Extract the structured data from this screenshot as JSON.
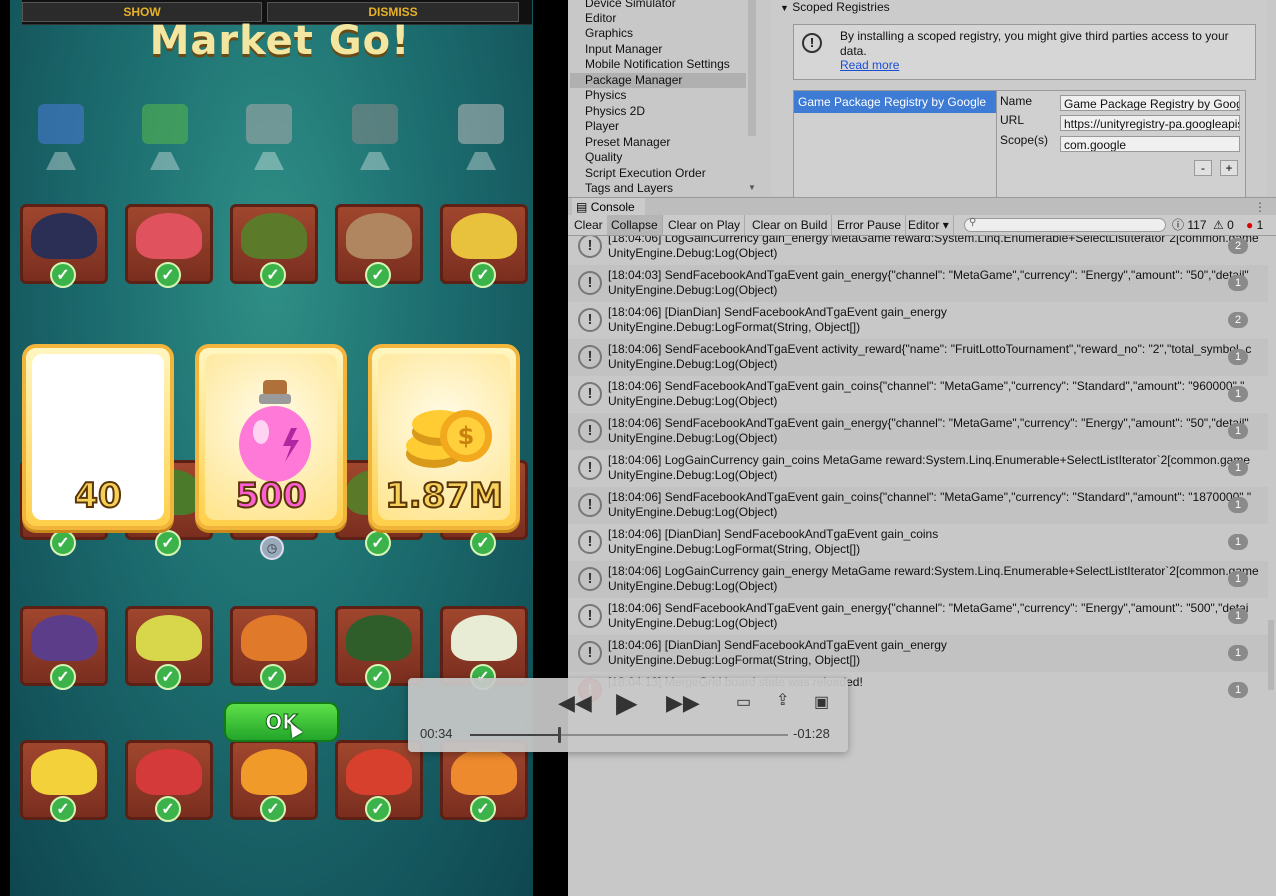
{
  "game": {
    "top_buttons": {
      "show": "SHOW",
      "dismiss": "DISMISS"
    },
    "title": "Market Go!",
    "reward_cards": [
      {
        "value": "40",
        "color": "#f6d15a"
      },
      {
        "value": "500",
        "color": "#ff5fd2",
        "item": "energy-potion"
      },
      {
        "value": "1.87M",
        "color": "#f6d15a",
        "item": "gold-coins"
      }
    ],
    "ok_button": "OK"
  },
  "editor": {
    "project_settings": {
      "items": [
        "Device Simulator",
        "Editor",
        "Graphics",
        "Input Manager",
        "Mobile Notification Settings",
        "Package Manager",
        "Physics",
        "Physics 2D",
        "Player",
        "Preset Manager",
        "Quality",
        "Script Execution Order",
        "Tags and Layers"
      ],
      "selected": "Package Manager"
    },
    "scoped_registries": {
      "header": "Scoped Registries",
      "info_text": "By installing a scoped registry, you might give third parties access to your data.",
      "read_more": "Read more",
      "registry_name": "Game Package Registry by Google",
      "fields": {
        "name_label": "Name",
        "name_value": "Game Package Registry by Google",
        "url_label": "URL",
        "url_value": "https://unityregistry-pa.googleapis.com",
        "scope_label": "Scope(s)",
        "scope_value": "com.google"
      },
      "remove_label": "-",
      "add_label": "+"
    },
    "console": {
      "tab_label": "Console",
      "toolbar": {
        "clear": "Clear",
        "collapse": "Collapse",
        "clear_on_play": "Clear on Play",
        "clear_on_build": "Clear on Build",
        "error_pause": "Error Pause",
        "editor": "Editor"
      },
      "counts": {
        "logs": "117",
        "warnings": "0",
        "errors": "1"
      },
      "rows": [
        {
          "line1": "[18:04:06] LogGainCurrency gain_energy MetaGame reward:System.Linq.Enumerable+SelectListIterator`2[common.game",
          "line2": "UnityEngine.Debug:Log(Object)",
          "count": "2"
        },
        {
          "line1": "[18:04:03] SendFacebookAndTgaEvent gain_energy{\"channel\": \"MetaGame\",\"currency\": \"Energy\",\"amount\": \"50\",\"detail\"",
          "line2": "UnityEngine.Debug:Log(Object)",
          "count": "1"
        },
        {
          "line1": "[18:04:06] [DianDian] SendFacebookAndTgaEvent gain_energy",
          "line2": "UnityEngine.Debug:LogFormat(String, Object[])",
          "count": "2"
        },
        {
          "line1": "[18:04:06] SendFacebookAndTgaEvent activity_reward{\"name\": \"FruitLottoTournament\",\"reward_no\": \"2\",\"total_symbol_c",
          "line2": "UnityEngine.Debug:Log(Object)",
          "count": "1"
        },
        {
          "line1": "[18:04:06] SendFacebookAndTgaEvent gain_coins{\"channel\": \"MetaGame\",\"currency\": \"Standard\",\"amount\": \"960000\",\"",
          "line2": "UnityEngine.Debug:Log(Object)",
          "count": "1"
        },
        {
          "line1": "[18:04:06] SendFacebookAndTgaEvent gain_energy{\"channel\": \"MetaGame\",\"currency\": \"Energy\",\"amount\": \"50\",\"detail\"",
          "line2": "UnityEngine.Debug:Log(Object)",
          "count": "1"
        },
        {
          "line1": "[18:04:06] LogGainCurrency gain_coins MetaGame reward:System.Linq.Enumerable+SelectListIterator`2[common.game",
          "line2": "UnityEngine.Debug:Log(Object)",
          "count": "1"
        },
        {
          "line1": "[18:04:06] SendFacebookAndTgaEvent gain_coins{\"channel\": \"MetaGame\",\"currency\": \"Standard\",\"amount\": \"1870000\",\"",
          "line2": "UnityEngine.Debug:Log(Object)",
          "count": "1"
        },
        {
          "line1": "[18:04:06] [DianDian] SendFacebookAndTgaEvent gain_coins",
          "line2": "UnityEngine.Debug:LogFormat(String, Object[])",
          "count": "1"
        },
        {
          "line1": "[18:04:06] LogGainCurrency gain_energy MetaGame reward:System.Linq.Enumerable+SelectListIterator`2[common.game",
          "line2": "UnityEngine.Debug:Log(Object)",
          "count": "1"
        },
        {
          "line1": "[18:04:06] SendFacebookAndTgaEvent gain_energy{\"channel\": \"MetaGame\",\"currency\": \"Energy\",\"amount\": \"500\",\"detai",
          "line2": "UnityEngine.Debug:Log(Object)",
          "count": "1"
        },
        {
          "line1": "[18:04:06] [DianDian] SendFacebookAndTgaEvent gain_energy",
          "line2": "UnityEngine.Debug:LogFormat(String, Object[])",
          "count": "1"
        },
        {
          "line1": "[18:04:13] MergeGrid board state was reloaded!",
          "line2": "",
          "count": "1"
        }
      ]
    }
  },
  "player": {
    "elapsed": "00:34",
    "remaining": "-01:28",
    "progress": 0.28
  }
}
